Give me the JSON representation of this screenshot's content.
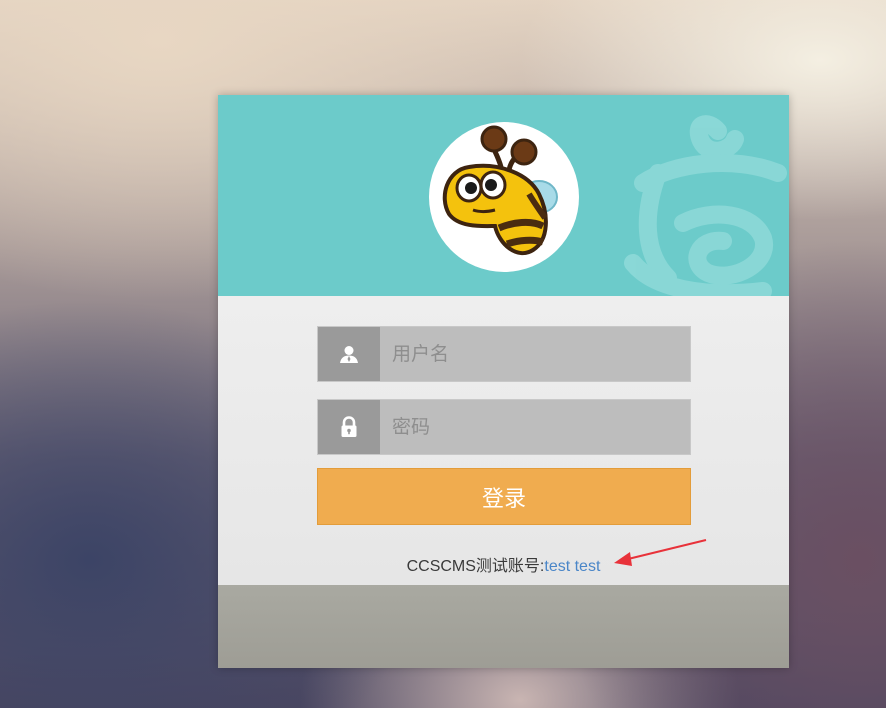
{
  "header": {
    "avatar_icon": "bee-mascot-icon",
    "watermark_icon": "calligraphy-watermark-icon",
    "colors": {
      "header_bg": "#6ccbca",
      "footer_bg": "#a9a9a1"
    }
  },
  "form": {
    "username": {
      "placeholder": "用户名",
      "value": "",
      "icon": "user-icon"
    },
    "password": {
      "placeholder": "密码",
      "value": "",
      "icon": "lock-icon"
    },
    "login_label": "登录",
    "login_color": "#f0ac4f"
  },
  "test_account": {
    "prefix": "CCSCMS测试账号:",
    "credentials": "test test",
    "annotation_icon": "red-arrow-icon",
    "link_color": "#4a86c8"
  }
}
